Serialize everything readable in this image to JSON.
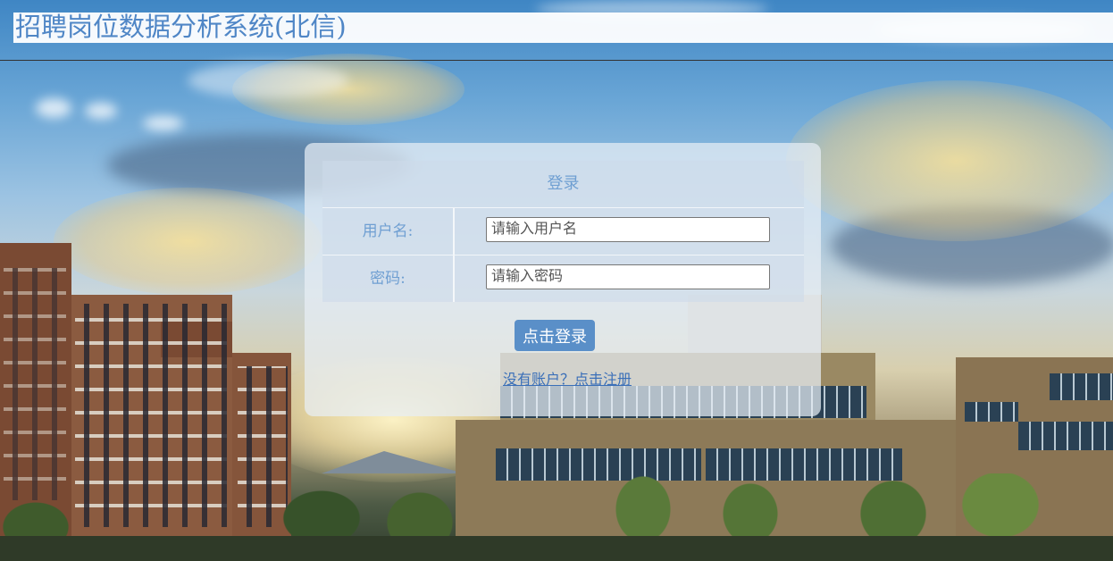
{
  "header": {
    "title": "招聘岗位数据分析系统(北信)"
  },
  "login": {
    "title": "登录",
    "username_label": "用户名:",
    "username_placeholder": "请输入用户名",
    "password_label": "密码:",
    "password_placeholder": "请输入密码",
    "submit_label": "点击登录",
    "register_link": "没有账户？点击注册"
  },
  "colors": {
    "accent_text": "#6f9fd2",
    "title_text": "#4f86c6",
    "button_bg": "#5a8fc8",
    "link": "#3a6fb8"
  }
}
